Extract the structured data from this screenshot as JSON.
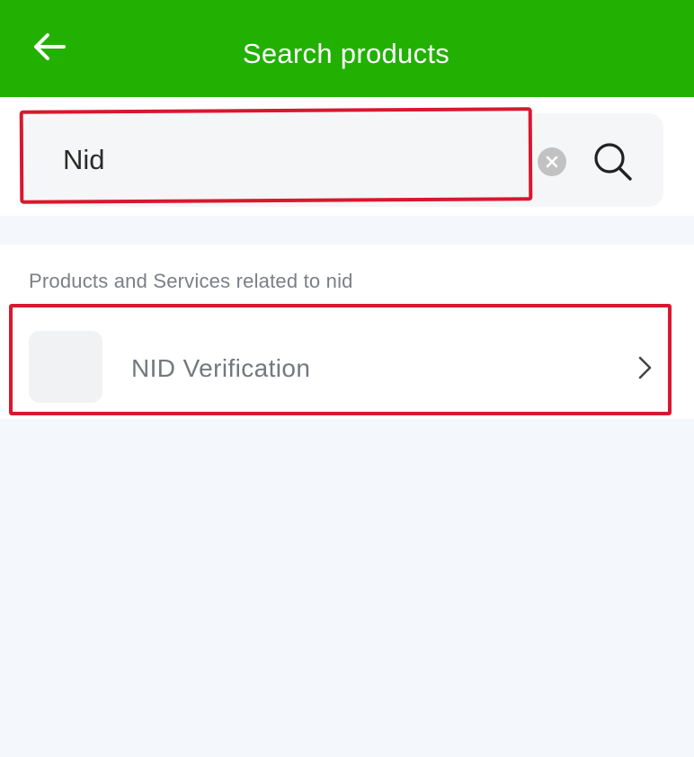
{
  "header": {
    "title": "Search products",
    "back_icon": "arrow-left-icon",
    "background_color": "#22b003"
  },
  "search": {
    "value": "Nid",
    "placeholder": "",
    "clear_icon": "clear-circle-icon",
    "search_icon": "search-icon"
  },
  "results": {
    "heading": "Products and Services related to nid",
    "items": [
      {
        "label": "NID Verification",
        "chevron_icon": "chevron-right-icon"
      }
    ]
  },
  "highlight_color": "#d8182e"
}
